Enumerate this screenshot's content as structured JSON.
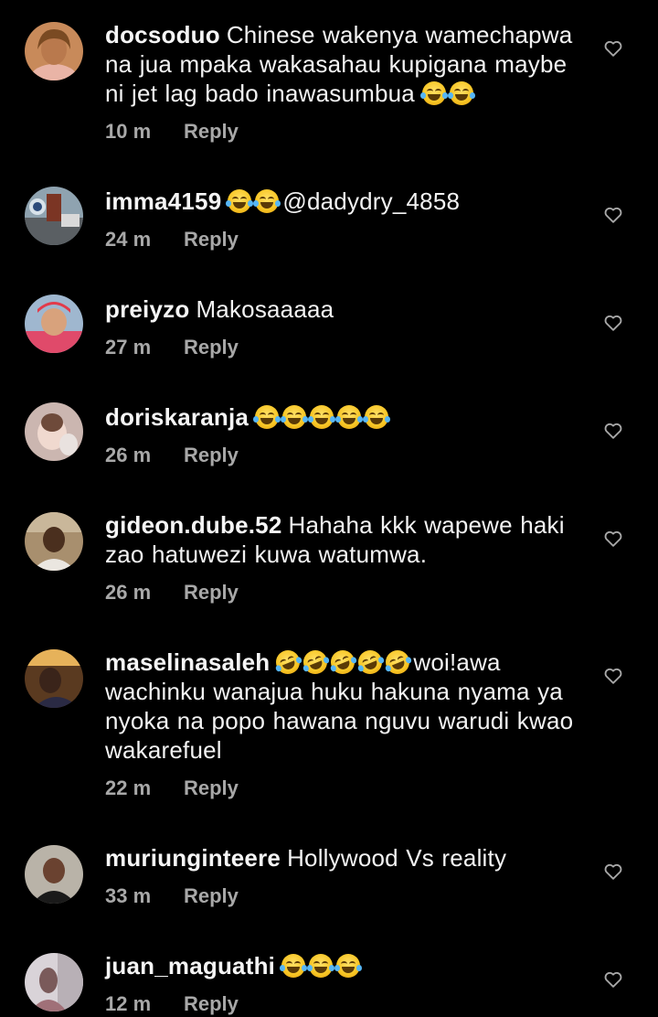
{
  "comments": [
    {
      "username": "docsoduo",
      "text": "Chinese wakenya wamechapwa na jua mpaka wakasahau kupigana maybe ni jet lag bado inawasumbua",
      "emojis": [
        "tears-of-joy-emoji",
        "tears-of-joy-emoji"
      ],
      "time": "10 m",
      "reply": "Reply"
    },
    {
      "username": "imma4159",
      "text": "",
      "emojis": [
        "tears-of-joy-emoji",
        "tears-of-joy-emoji"
      ],
      "text_after": "@dadydry_4858",
      "time": "24 m",
      "reply": "Reply"
    },
    {
      "username": "preiyzo",
      "text": "Makosaaaaa",
      "time": "27 m",
      "reply": "Reply"
    },
    {
      "username": "doriskaranja",
      "text": "",
      "emojis": [
        "tears-of-joy-emoji",
        "tears-of-joy-emoji",
        "tears-of-joy-emoji",
        "tears-of-joy-emoji",
        "tears-of-joy-emoji"
      ],
      "time": "26 m",
      "reply": "Reply"
    },
    {
      "username": "gideon.dube.52",
      "text": "Hahaha kkk wapewe haki zao hatuwezi kuwa watumwa.",
      "time": "26 m",
      "reply": "Reply"
    },
    {
      "username": "maselinasaleh",
      "text": "",
      "emojis": [
        "rolling-on-floor-laughing-emoji",
        "rolling-on-floor-laughing-emoji",
        "rolling-on-floor-laughing-emoji",
        "rolling-on-floor-laughing-emoji",
        "rolling-on-floor-laughing-emoji"
      ],
      "text_after": "woi!awa wachinku wanajua huku hakuna nyama ya nyoka na popo hawana nguvu warudi kwao wakarefuel",
      "time": "22 m",
      "reply": "Reply"
    },
    {
      "username": "muriunginteere",
      "text": "Hollywood Vs reality",
      "time": "33 m",
      "reply": "Reply"
    },
    {
      "username": "juan_maguathi",
      "text": "",
      "emojis": [
        "tears-of-joy-emoji",
        "tears-of-joy-emoji",
        "tears-of-joy-emoji"
      ],
      "time": "12 m",
      "reply": "Reply"
    }
  ],
  "colors": {
    "background": "#000000",
    "text": "#f2f2f2",
    "meta": "#a8a8a8"
  },
  "icons": {
    "like": "heart-outline-icon"
  }
}
